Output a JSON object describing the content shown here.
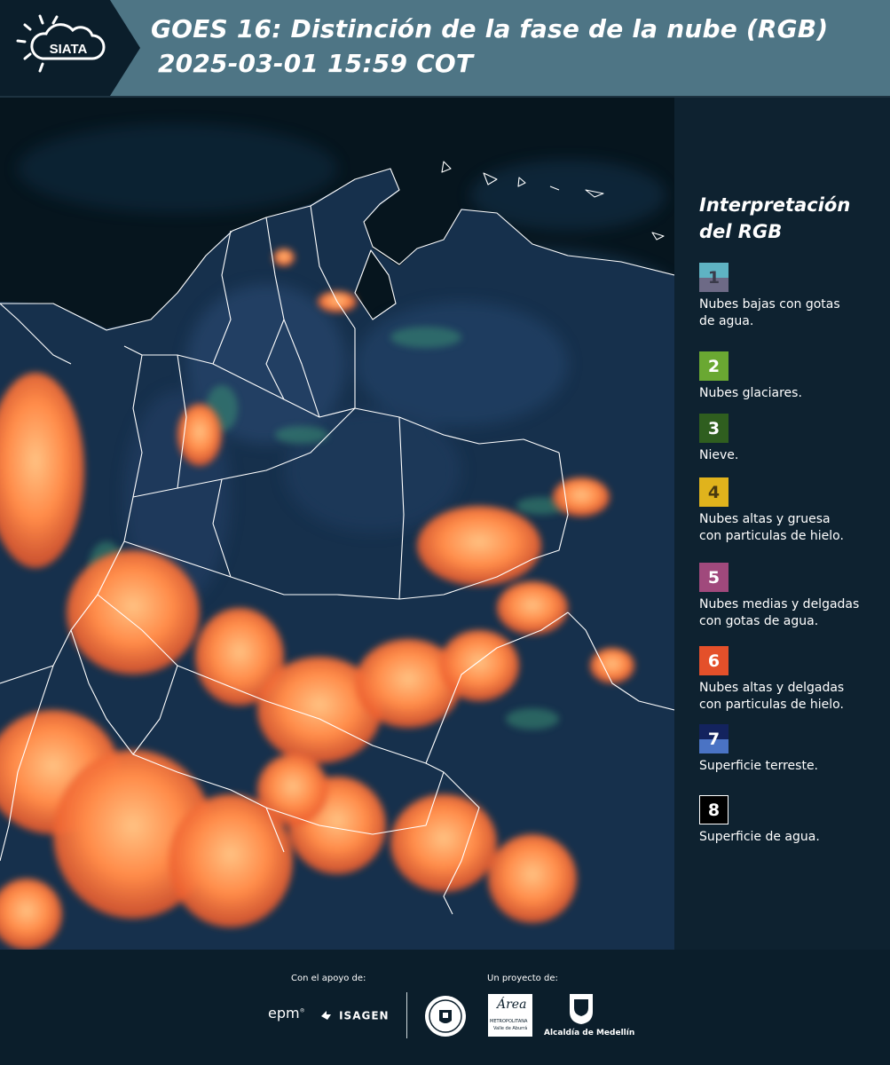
{
  "header": {
    "logo_text": "SIATA",
    "title_line1": "GOES 16: Distinción de la fase de la nube (RGB)",
    "title_line2": "2025-03-01 15:59 COT"
  },
  "legend": {
    "title_line1": "Interpretación",
    "title_line2": "del RGB",
    "items": [
      {
        "number": "1",
        "label_line1": "Nubes bajas con gotas",
        "label_line2": "de agua.",
        "color_top": "#5fb3c3",
        "color_bottom": "#6d6a86",
        "text_color": "#3a3a4a"
      },
      {
        "number": "2",
        "label_line1": "Nubes glaciares.",
        "label_line2": "",
        "color_top": "#6aa832",
        "color_bottom": "#6aa832",
        "text_color": "#ffffff"
      },
      {
        "number": "3",
        "label_line1": "Nieve.",
        "label_line2": "",
        "color_top": "#2f5e1f",
        "color_bottom": "#2f5e1f",
        "text_color": "#ffffff"
      },
      {
        "number": "4",
        "label_line1": "Nubes altas y gruesa",
        "label_line2": "con particulas de hielo.",
        "color_top": "#e0b31c",
        "color_bottom": "#e0b31c",
        "text_color": "#4a3a10"
      },
      {
        "number": "5",
        "label_line1": "Nubes medias y delgadas",
        "label_line2": "con gotas de agua.",
        "color_top": "#a0497c",
        "color_bottom": "#a0497c",
        "text_color": "#ffffff"
      },
      {
        "number": "6",
        "label_line1": "Nubes altas y delgadas",
        "label_line2": "con particulas de hielo.",
        "color_top": "#e4502a",
        "color_bottom": "#e4502a",
        "text_color": "#ffffff"
      },
      {
        "number": "7",
        "label_line1": "Superficie terreste.",
        "label_line2": "",
        "color_top": "#13235e",
        "color_bottom": "#4a73c4",
        "text_color": "#ffffff"
      },
      {
        "number": "8",
        "label_line1": "Superficie de agua.",
        "label_line2": "",
        "color_top": "#000000",
        "color_bottom": "#000000",
        "text_color": "#ffffff"
      }
    ]
  },
  "footer": {
    "support_caption": "Con el apoyo de:",
    "project_caption": "Un proyecto de:",
    "epm_logo": "epm",
    "isagen_logo": "ISAGEN",
    "area_logo": "Área",
    "area_sub": "METROPOLITANA",
    "area_sub2": "Valle de Aburrá",
    "alcaldia_logo": "Alcaldía de Medellín"
  },
  "colors": {
    "header_bg": "#4e7585",
    "logo_bg": "#0b1e2b",
    "page_bg": "#0b1e2b",
    "cloud_ice": "#ff7a3a",
    "cloud_ice_light": "#ffb070",
    "land": "#1b3350",
    "water": "#06151e",
    "border_line": "#ffffff"
  }
}
